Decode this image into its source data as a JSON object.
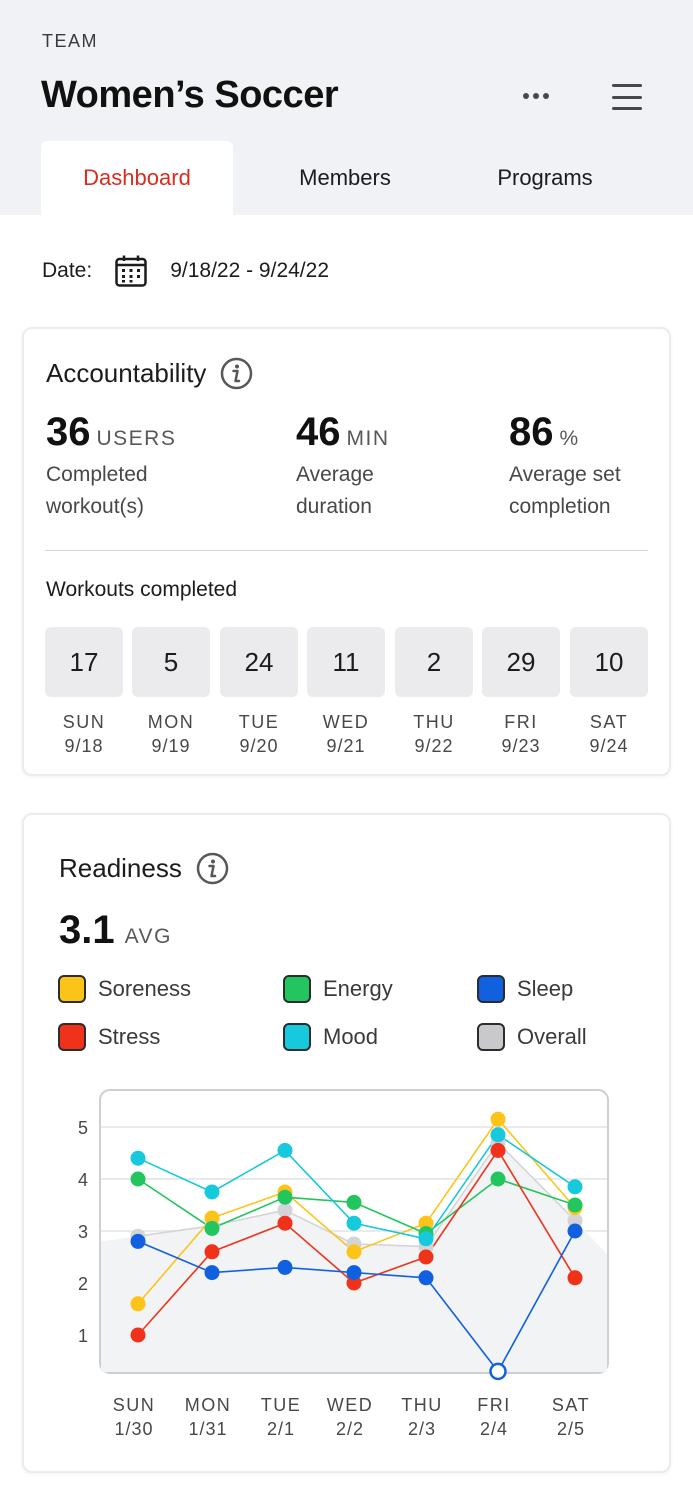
{
  "header": {
    "team_label": "TEAM",
    "team_name": "Women’s Soccer",
    "more_icon": "more-horizontal-icon",
    "menu_icon": "hamburger-menu-icon"
  },
  "tabs": [
    {
      "label": "Dashboard",
      "active": true
    },
    {
      "label": "Members",
      "active": false
    },
    {
      "label": "Programs",
      "active": false
    }
  ],
  "date": {
    "label": "Date:",
    "icon": "calendar-icon",
    "value": "9/18/22 - 9/24/22"
  },
  "accountability": {
    "title": "Accountability",
    "info_icon": "info-icon",
    "stats": [
      {
        "value": "36",
        "unit": "USERS",
        "description": "Completed workout(s)"
      },
      {
        "value": "46",
        "unit": "MIN",
        "description": "Average duration"
      },
      {
        "value": "86",
        "unit": "%",
        "description": "Average set completion"
      }
    ],
    "workouts_title": "Workouts completed",
    "days": [
      {
        "count": "17",
        "day": "SUN",
        "date": "9/18"
      },
      {
        "count": "5",
        "day": "MON",
        "date": "9/19"
      },
      {
        "count": "24",
        "day": "TUE",
        "date": "9/20"
      },
      {
        "count": "11",
        "day": "WED",
        "date": "9/21"
      },
      {
        "count": "2",
        "day": "THU",
        "date": "9/22"
      },
      {
        "count": "29",
        "day": "FRI",
        "date": "9/23"
      },
      {
        "count": "10",
        "day": "SAT",
        "date": "9/24"
      }
    ]
  },
  "readiness": {
    "title": "Readiness",
    "info_icon": "info-icon",
    "avg_value": "3.1",
    "avg_unit": "AVG",
    "legend": [
      {
        "label": "Soreness",
        "color": "#fcc419"
      },
      {
        "label": "Energy",
        "color": "#22c55e"
      },
      {
        "label": "Sleep",
        "color": "#1160e0"
      },
      {
        "label": "Stress",
        "color": "#f0321a"
      },
      {
        "label": "Mood",
        "color": "#17c9dc"
      },
      {
        "label": "Overall",
        "color": "#c9c9cc"
      }
    ]
  },
  "chart_data": {
    "type": "line",
    "categories": [
      "SUN 1/30",
      "MON 1/31",
      "TUE 2/1",
      "WED 2/2",
      "THU 2/3",
      "FRI 2/4",
      "SAT 2/5"
    ],
    "category_days": [
      "SUN",
      "MON",
      "TUE",
      "WED",
      "THU",
      "FRI",
      "SAT"
    ],
    "category_dates": [
      "1/30",
      "1/31",
      "2/1",
      "2/2",
      "2/3",
      "2/4",
      "2/5"
    ],
    "yticks": [
      "1",
      "2",
      "3",
      "4",
      "5"
    ],
    "ylim": [
      0.3,
      5.5
    ],
    "grid": true,
    "series": [
      {
        "name": "Overall",
        "color": "#c9c9cc",
        "values": [
          2.9,
          3.1,
          3.4,
          2.75,
          2.7,
          4.7,
          3.2
        ],
        "area": true
      },
      {
        "name": "Soreness",
        "color": "#fcc419",
        "values": [
          1.6,
          3.25,
          3.75,
          2.6,
          3.15,
          5.15,
          3.45
        ]
      },
      {
        "name": "Energy",
        "color": "#22c55e",
        "values": [
          4.0,
          3.05,
          3.65,
          3.55,
          2.95,
          4.0,
          3.5
        ]
      },
      {
        "name": "Mood",
        "color": "#17c9dc",
        "values": [
          4.4,
          3.75,
          4.55,
          3.15,
          2.85,
          4.85,
          3.85
        ]
      },
      {
        "name": "Stress",
        "color": "#f0321a",
        "values": [
          1.0,
          2.6,
          3.15,
          2.0,
          2.5,
          4.55,
          2.1
        ]
      },
      {
        "name": "Sleep",
        "color": "#1160e0",
        "values": [
          2.8,
          2.2,
          2.3,
          2.2,
          2.1,
          0.3,
          3.0
        ],
        "hollow_index": 5
      }
    ]
  }
}
